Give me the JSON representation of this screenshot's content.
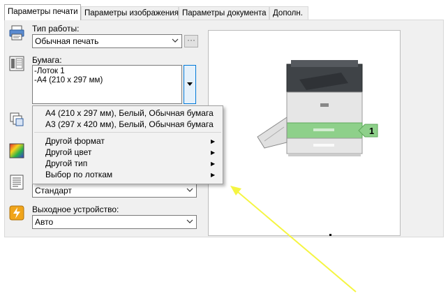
{
  "tabs": [
    {
      "label": "Параметры печати",
      "active": true
    },
    {
      "label": "Параметры изображения",
      "active": false
    },
    {
      "label": "Параметры документа",
      "active": false
    },
    {
      "label": "Дополн.",
      "active": false
    }
  ],
  "job_type": {
    "label": "Тип работы:",
    "value": "Обычная печать",
    "more_label": "···"
  },
  "paper": {
    "label": "Бумага:",
    "lines": [
      "-Лоток 1",
      "-A4 (210 x 297 мм)"
    ]
  },
  "paper_menu": {
    "items": [
      {
        "label": "A4 (210 x 297 мм), Белый, Обычная бумага",
        "submenu": false
      },
      {
        "label": "A3 (297 x 420 мм), Белый, Обычная бумага",
        "submenu": false
      },
      {
        "label": "Другой формат",
        "submenu": true
      },
      {
        "label": "Другой цвет",
        "submenu": true
      },
      {
        "label": "Другой тип",
        "submenu": true
      },
      {
        "label": "Выбор по лоткам",
        "submenu": true
      }
    ]
  },
  "quality": {
    "value": "Стандарт"
  },
  "output": {
    "label": "Выходное устройство:",
    "value": "Авто"
  },
  "preview": {
    "tray_number": "1"
  },
  "colors": {
    "highlight": "#0078d7",
    "tray_green": "#8ed08a",
    "annotation": "#f5f542"
  }
}
